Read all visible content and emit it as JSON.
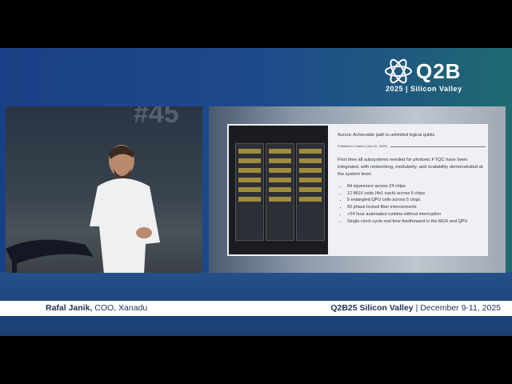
{
  "logo": {
    "brand": "Q2B",
    "subtitle": "2025 | Silicon Valley"
  },
  "camera": {
    "backdrop_text": "#45"
  },
  "slide": {
    "title": "Aurora: Achievable path to unlimited logical qubits",
    "published": "Published in Nature (Jan 22, 2025)",
    "intro": "First time all subsystems needed for photonic FTQC have been integrated, with networking, modularity, and scalability demonstrated at the system level.",
    "bullets": [
      "84 squeezers across 24 chips",
      "12 MUX units (4x1 each) across 6 chips",
      "5 entangled QPU cells across 5 chips",
      "60 phase locked fiber interconnects",
      ">24 hour automated runtime without interruption",
      "Single-clock-cycle real-time feedforward in the MUX and QPU"
    ]
  },
  "lower_third": {
    "speaker_name": "Rafal Janik,",
    "speaker_role": "COO, Xanadu",
    "event": "Q2B25 Silicon Valley",
    "separator": "|",
    "dates": "December 9-11, 2025"
  }
}
